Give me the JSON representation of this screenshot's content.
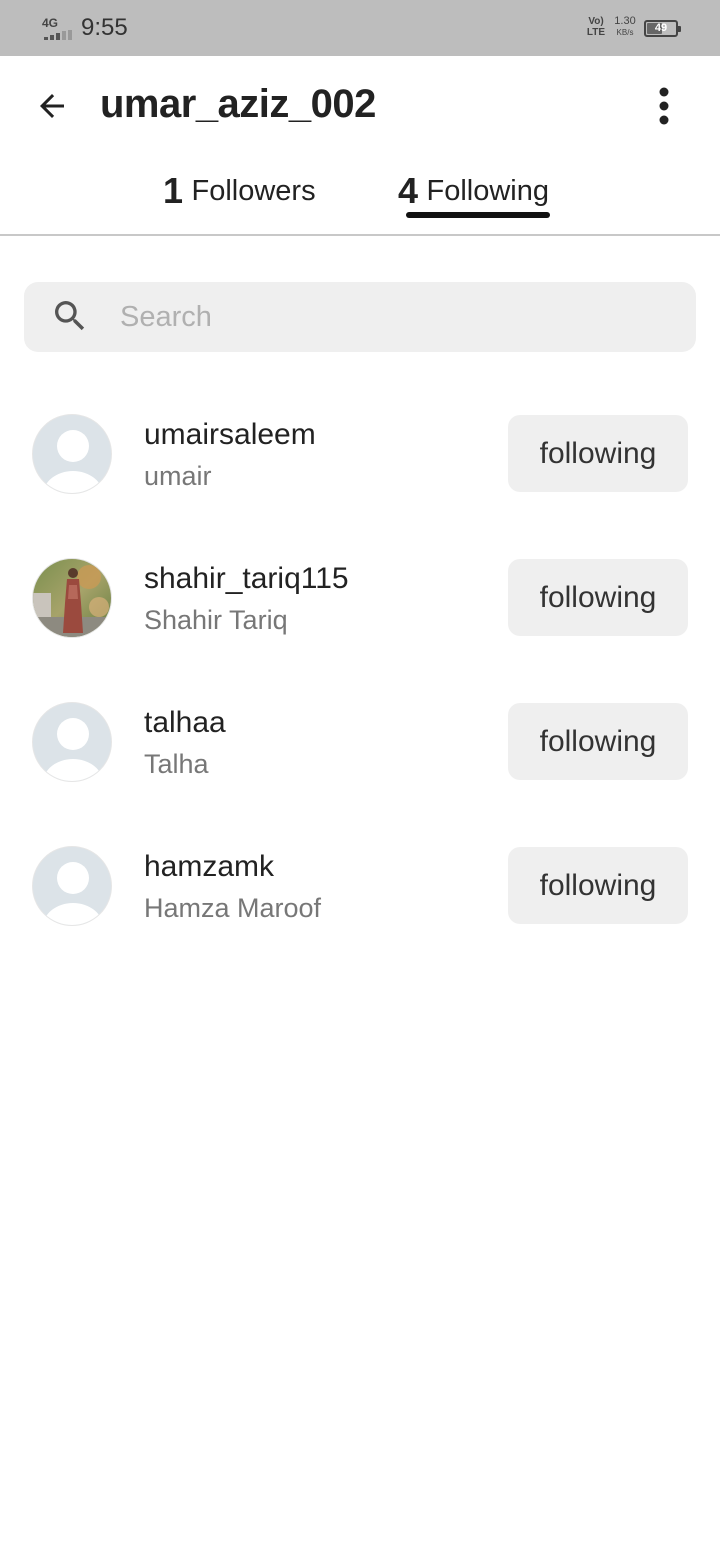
{
  "status_bar": {
    "network": "4G",
    "time": "9:55",
    "volte": "Vo) LTE",
    "speed_value": "1.30",
    "speed_unit": "KB/s",
    "battery": "49",
    "battery_level": 0.49
  },
  "header": {
    "title": "umar_aziz_002",
    "back_icon": "arrow-left-icon",
    "more_icon": "more-vert-icon"
  },
  "tabs": [
    {
      "count": "1",
      "label": "Followers",
      "active": false
    },
    {
      "count": "4",
      "label": "Following",
      "active": true
    }
  ],
  "search": {
    "placeholder": "Search",
    "value": "",
    "icon": "search-icon"
  },
  "users": [
    {
      "username": "umairsaleem",
      "name": "umair",
      "button": "following",
      "avatar": "default-avatar-icon"
    },
    {
      "username": "shahir_tariq115",
      "name": "Shahir Tariq",
      "button": "following",
      "avatar": "photo"
    },
    {
      "username": "talhaa",
      "name": "Talha",
      "button": "following",
      "avatar": "default-avatar-icon"
    },
    {
      "username": "hamzamk",
      "name": "Hamza Maroof",
      "button": "following",
      "avatar": "default-avatar-icon"
    }
  ]
}
